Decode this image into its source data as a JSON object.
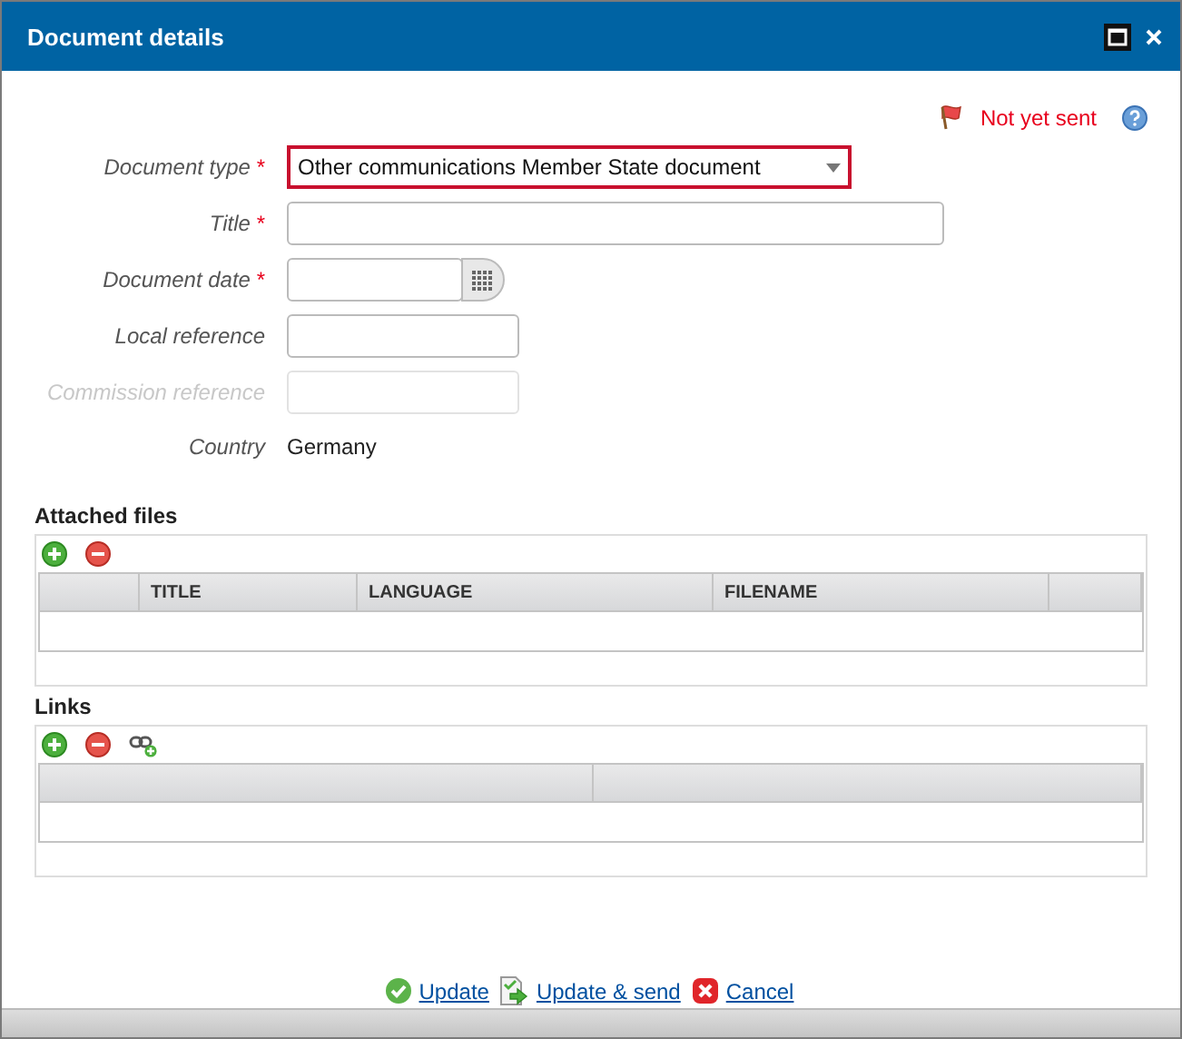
{
  "window": {
    "title": "Document details"
  },
  "status": {
    "label": "Not yet sent"
  },
  "fields": [
    {
      "label": "Document type",
      "required_mark": "*",
      "kind": "select",
      "value": "Other communications Member State document",
      "highlighted": true,
      "disabled": false
    },
    {
      "label": "Title",
      "required_mark": "*",
      "kind": "text",
      "highlighted": false,
      "disabled": false
    },
    {
      "label": "Document date",
      "required_mark": "*",
      "kind": "date",
      "highlighted": false,
      "disabled": false
    },
    {
      "label": "Local reference",
      "kind": "text",
      "highlighted": false,
      "disabled": false
    },
    {
      "label": "Commission reference",
      "kind": "text",
      "highlighted": false,
      "disabled": true
    },
    {
      "label": "Country",
      "kind": "static",
      "value": "Germany"
    }
  ],
  "attached_files": {
    "title": "Attached files",
    "tools": [
      {
        "kind": "add"
      },
      {
        "kind": "remove"
      }
    ],
    "columns": [
      "",
      "TITLE",
      "LANGUAGE",
      "FILENAME",
      ""
    ]
  },
  "links": {
    "title": "Links",
    "tools": [
      {
        "kind": "add"
      },
      {
        "kind": "remove"
      },
      {
        "kind": "link"
      }
    ],
    "columns": [
      "",
      ""
    ]
  },
  "actions": [
    {
      "kind": "update",
      "label": "Update"
    },
    {
      "kind": "send",
      "label": "Update & send"
    },
    {
      "kind": "cancel",
      "label": "Cancel"
    }
  ]
}
